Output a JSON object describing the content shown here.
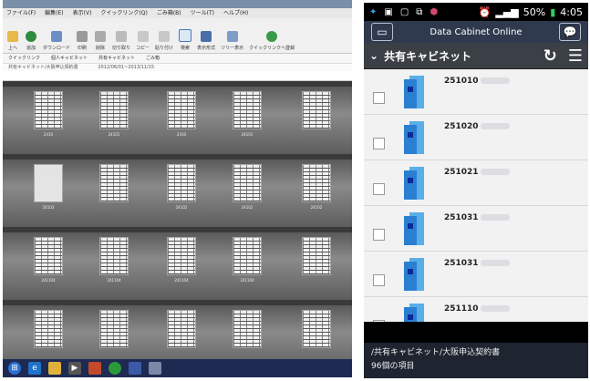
{
  "desktop": {
    "menu": [
      "ファイル(F)",
      "編集(E)",
      "表示(V)",
      "クイックリンク(Q)",
      "ごみ箱(B)",
      "ツール(T)",
      "ヘルプ(H)"
    ],
    "ribbon": [
      "上へ",
      "追加",
      "ダウンロード",
      "印刷",
      "削除",
      "切り取り",
      "コピー",
      "貼り付け",
      "検索",
      "表示形式",
      "ツリー表示",
      "クイックリンクへ登録"
    ],
    "quick": [
      "クイックリンク",
      "個人キャビネット",
      "共有キャビネット",
      "ごみ箱"
    ],
    "path": "共有キャビネット/大阪申込契約書",
    "date_range": "2012/06/01~2013/11/15",
    "captions": [
      "2410",
      "24101",
      "2410",
      "24101",
      "24103",
      "24102",
      "24102",
      "24102",
      "241104",
      "241104",
      "241104",
      "241104"
    ]
  },
  "phone": {
    "status_battery": "50%",
    "status_time": "4:05",
    "app_title": "Data Cabinet Online",
    "folder_title": "共有キャビネット",
    "items": [
      {
        "label": "251010"
      },
      {
        "label": "251020"
      },
      {
        "label": "251021"
      },
      {
        "label": "251031"
      },
      {
        "label": "251031"
      },
      {
        "label": "251110"
      }
    ],
    "footer_path": "/共有キャビネット/大阪申込契約書",
    "footer_count": "96個の項目"
  }
}
